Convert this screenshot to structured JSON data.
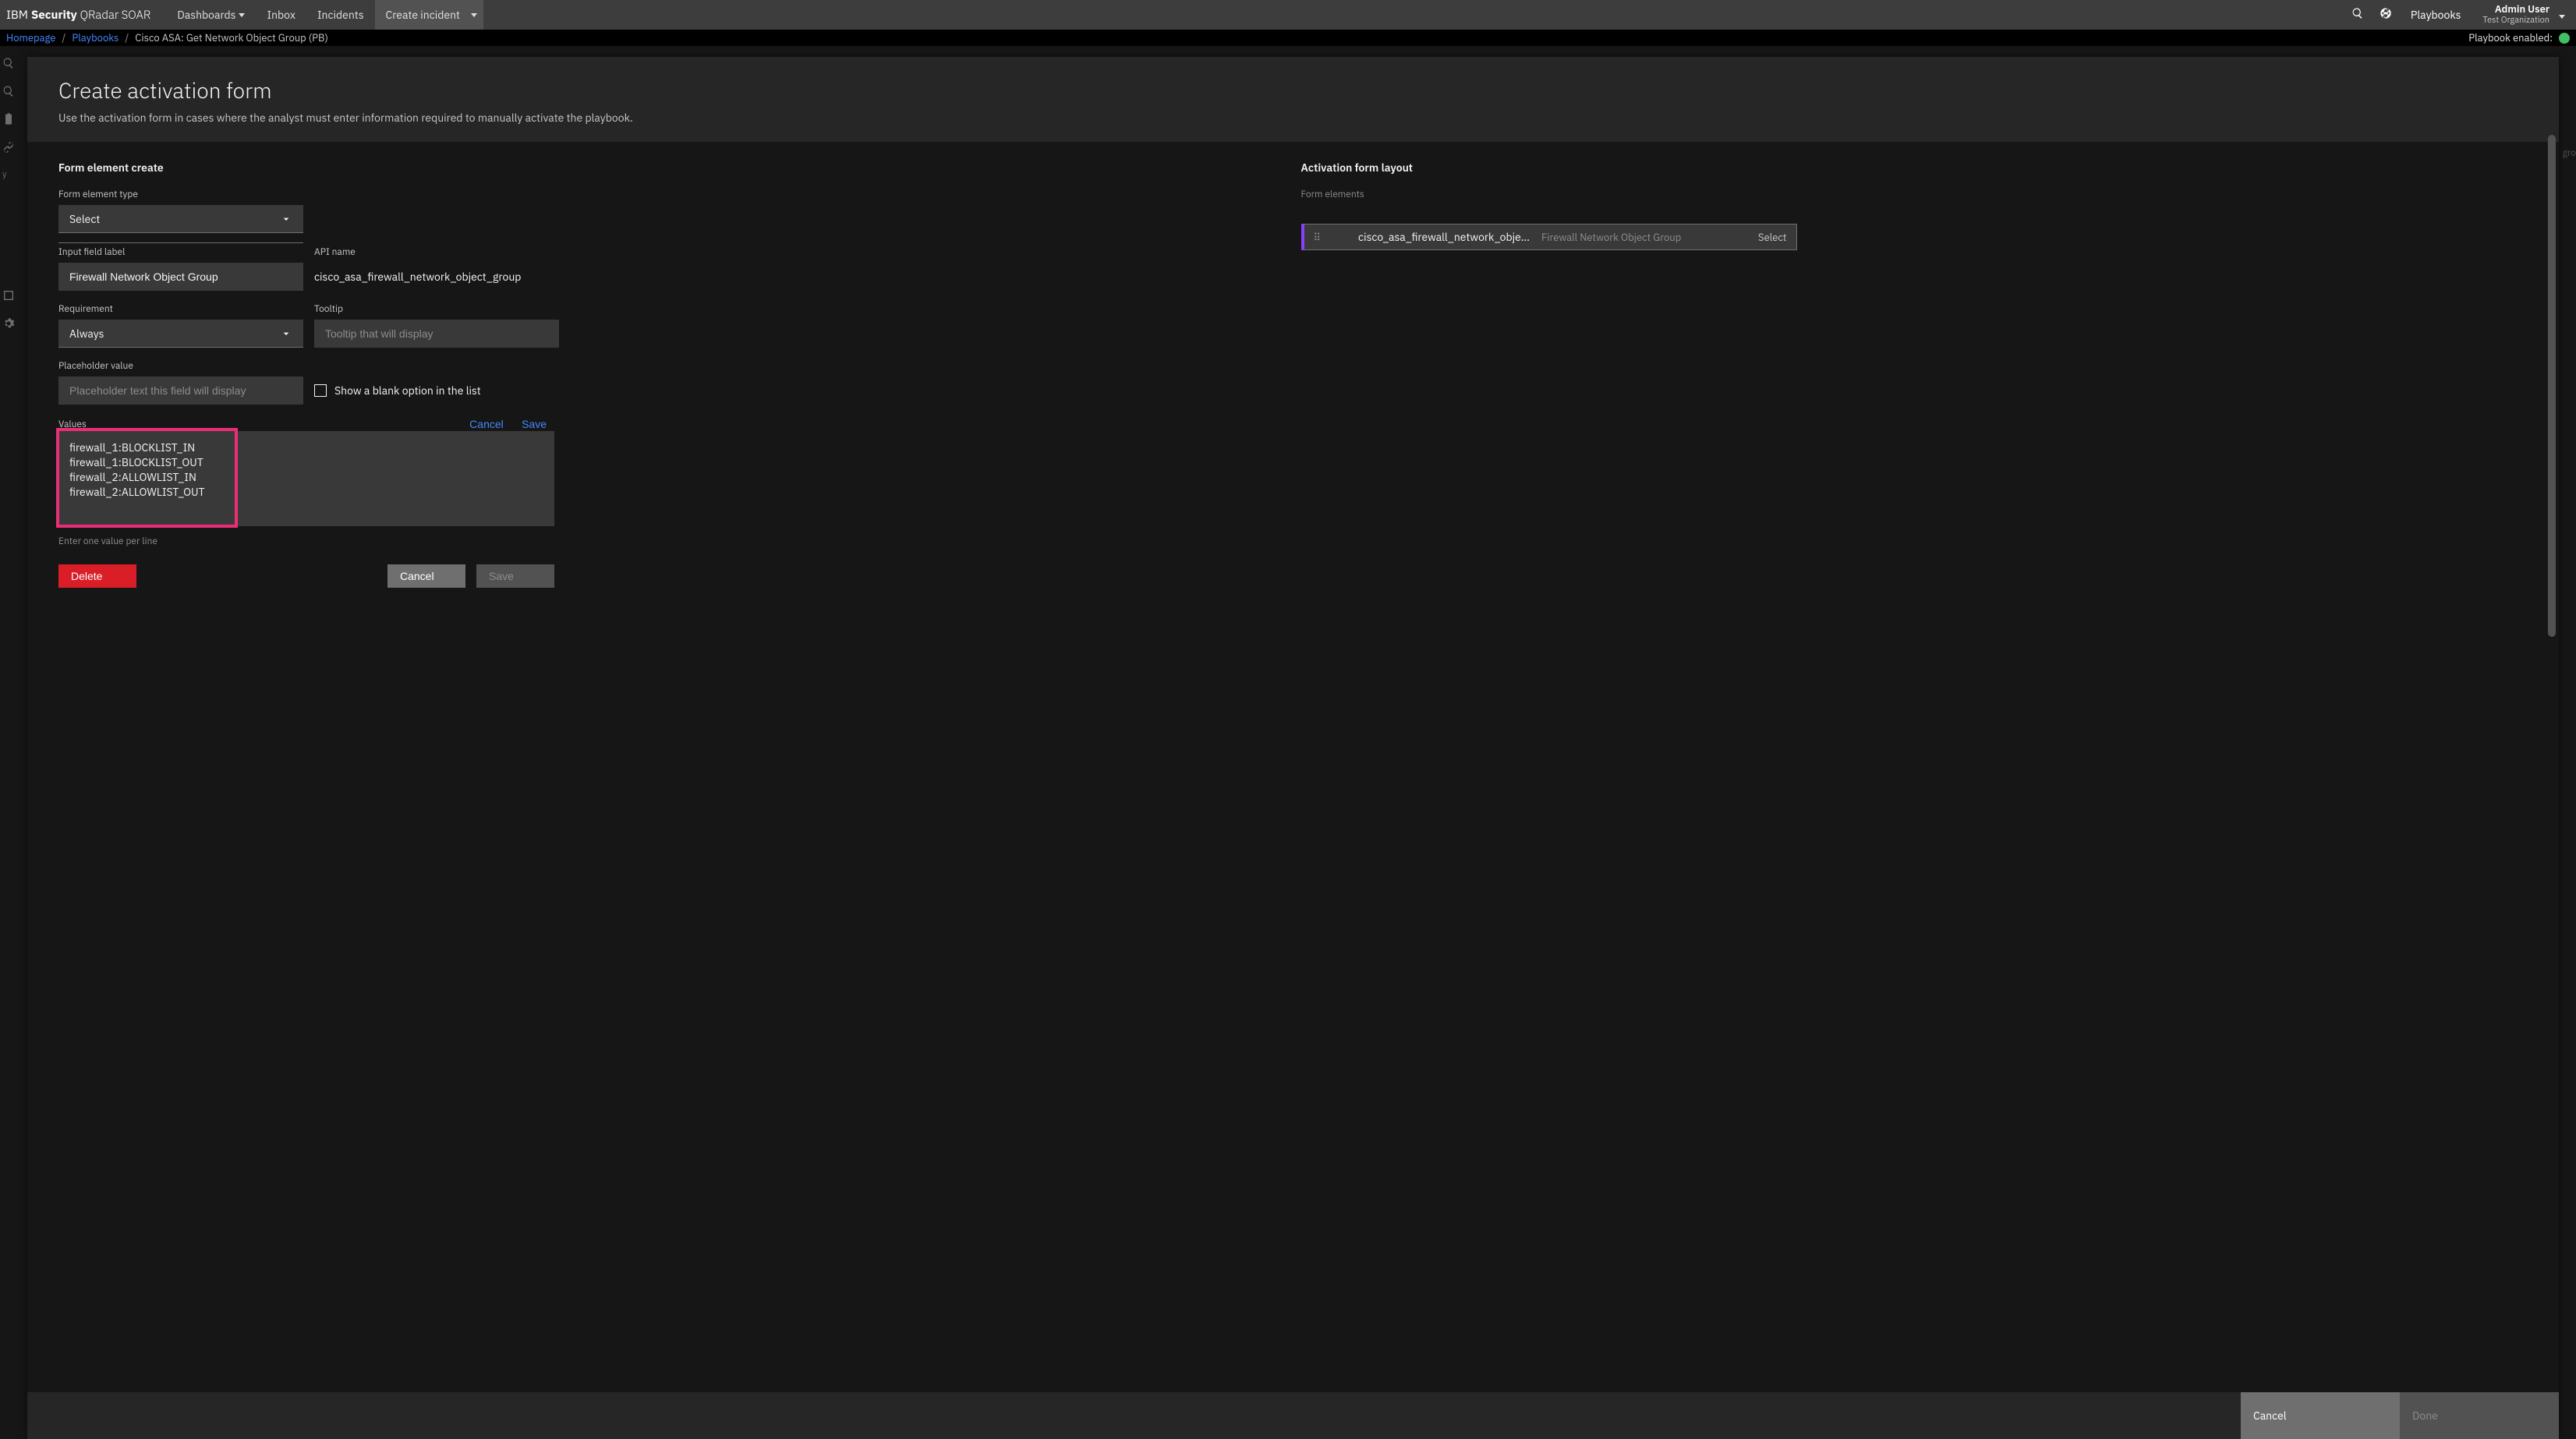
{
  "header": {
    "logo_ibm": "IBM",
    "logo_sec": "Security",
    "logo_prod": "QRadar SOAR",
    "nav": {
      "dashboards": "Dashboards",
      "inbox": "Inbox",
      "incidents": "Incidents",
      "create_incident": "Create incident"
    },
    "playbooks_link": "Playbooks",
    "user_name": "Admin User",
    "user_org": "Test Organization"
  },
  "crumbs": {
    "home": "Homepage",
    "playbooks": "Playbooks",
    "current": "Cisco ASA: Get Network Object Group (PB)",
    "status_label": "Playbook enabled:"
  },
  "modal": {
    "title": "Create activation form",
    "subtitle": "Use the activation form in cases where the analyst must enter information required to manually activate the playbook.",
    "left": {
      "section_title": "Form element create",
      "type_label": "Form element type",
      "type_value": "Select",
      "input_label_label": "Input field label",
      "input_label_value": "Firewall Network Object Group",
      "api_name_label": "API name",
      "api_name_value": "cisco_asa_firewall_network_object_group",
      "requirement_label": "Requirement",
      "requirement_value": "Always",
      "tooltip_label": "Tooltip",
      "tooltip_placeholder": "Tooltip that will display",
      "placeholder_label": "Placeholder value",
      "placeholder_placeholder": "Placeholder text this field will display",
      "show_blank_label": "Show a blank option in the list",
      "values_label": "Values",
      "values_cancel": "Cancel",
      "values_save": "Save",
      "values_text": "firewall_1:BLOCKLIST_IN\nfirewall_1:BLOCKLIST_OUT\nfirewall_2:ALLOWLIST_IN\nfirewall_2:ALLOWLIST_OUT",
      "values_hint": "Enter one value per line",
      "delete_btn": "Delete",
      "cancel_btn": "Cancel",
      "save_btn": "Save"
    },
    "right": {
      "section_title": "Activation form layout",
      "sub_label": "Form elements",
      "item_fn": "cisco_asa_firewall_network_object_g…",
      "item_lbl": "Firewall Network Object Group",
      "item_type": "Select"
    },
    "footer": {
      "cancel": "Cancel",
      "done": "Done"
    }
  },
  "right_edge_hint": "gro"
}
